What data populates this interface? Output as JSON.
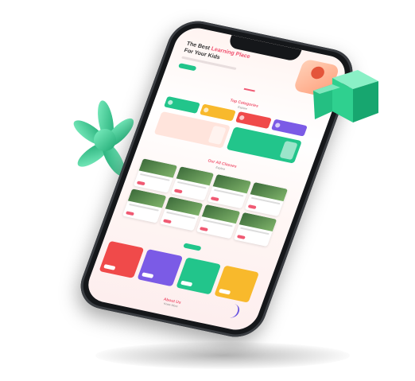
{
  "hero": {
    "title_line1_prefix": "The Best",
    "title_line1_highlight": "Learning Place",
    "title_line2": "For Your Kids"
  },
  "categories_section": {
    "title": "Top Categories",
    "subtitle": "Explore"
  },
  "classes_section": {
    "title": "Our All Classes",
    "subtitle": "Explore"
  },
  "about_section": {
    "title": "About Us",
    "subtitle": "Know More"
  },
  "colors": {
    "accent_pink": "#f05a73",
    "green": "#22c58b",
    "yellow": "#f8b92c",
    "red": "#f04a4a",
    "purple": "#7b5be6"
  },
  "icons": {
    "cube": "green-cube-icon",
    "flower": "green-flower-icon"
  }
}
